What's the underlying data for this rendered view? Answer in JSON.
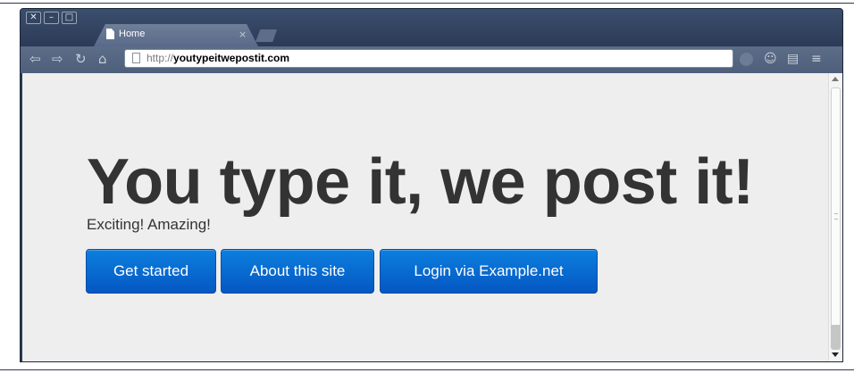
{
  "window": {
    "controls": {
      "close": "✕",
      "minimize": "–",
      "maximize": "□"
    }
  },
  "tab": {
    "title": "Home",
    "close": "×"
  },
  "toolbar": {
    "back": "⇦",
    "forward": "⇨",
    "reload": "↻",
    "home": "⌂",
    "url_protocol": "http://",
    "url_host": "youtypeitwepostit.com",
    "menu": "≡"
  },
  "page": {
    "heading": "You type it, we post it!",
    "subtitle": "Exciting! Amazing!",
    "buttons": [
      {
        "label": "Get started"
      },
      {
        "label": "About this site"
      },
      {
        "label": "Login via Example.net"
      }
    ]
  },
  "colors": {
    "button": "#0a6fd6",
    "content_bg": "#eeeeee",
    "heading": "#333333",
    "chrome": "#2b3a54"
  }
}
